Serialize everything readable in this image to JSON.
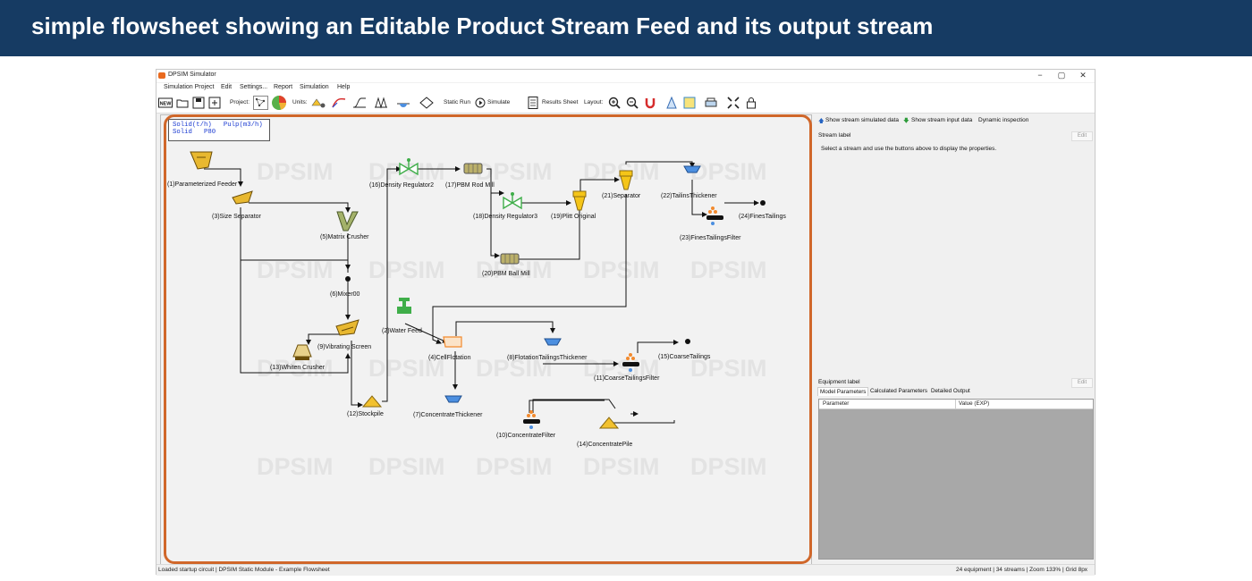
{
  "banner": {
    "title": "simple flowsheet showing an Editable Product Stream Feed and its output stream"
  },
  "window": {
    "title": "DPSIM Simulator",
    "controls": {
      "minimize": "−",
      "maximize": "▢",
      "close": "✕"
    }
  },
  "menu": [
    "Simulation Project",
    "Edit",
    "Settings...",
    "Report",
    "Simulation",
    "Help"
  ],
  "toolbar": {
    "project_label": "Project:",
    "units_label": "Units:",
    "static_run": "Static Run",
    "simulate": "Simulate",
    "results_sheet": "Results Sheet",
    "layout_label": "Layout:",
    "new_label": "NEW"
  },
  "legend": {
    "line1": "Solid(t/h)   Pulp(m3/h)",
    "line2": "Solid   P80"
  },
  "watermark": "DPSIM",
  "nodes": {
    "n1": "(1)Parameterized Feeder",
    "n3": "(3)Size Separator",
    "n5": "(5)Matrix Crusher",
    "n6": "(6)Mixer00",
    "n9": "(9)Vibrating Screen",
    "n13": "(13)Whiten Crusher",
    "n12": "(12)Stockpile",
    "n16": "(16)Density Regulator2",
    "n17": "(17)PBM Rod Mill",
    "n18": "(18)Density Regulator3",
    "n19": "(19)Plitt Original",
    "n20": "(20)PBM Ball Mill",
    "n21": "(21)Separator",
    "n22": "(22)TailinsThickener",
    "n23": "(23)FinesTailingsFilter",
    "n24": "(24)FinesTailings",
    "n2": "(2)Water Feed",
    "n4": "(4)CellFlotation",
    "n8": "(8)FlotationTailingsThickener",
    "n11": "(11)CoarseTailingsFilter",
    "n15": "(15)CoarseTailings",
    "n7": "(7)ConcentrateThickener",
    "n10": "(10)ConcentrateFilter",
    "n14": "(14)ConcentratePile"
  },
  "right_panel": {
    "show_simulated": "Show stream simulated data",
    "show_input": "Show stream input data",
    "dynamic": "Dynamic inspection",
    "stream_label": "Stream label",
    "edit": "Edit",
    "hint": "Select a stream and use the buttons above to display the properties.",
    "equipment_label": "Equipment label",
    "tabs": [
      "Model Parameters",
      "Calculated Parameters",
      "Detailed Output"
    ],
    "grid_cols": [
      "Parameter",
      "Value (EXP)"
    ]
  },
  "status": {
    "left": "Loaded startup circuit | DPSIM Static Module - Example Flowsheet",
    "right": "24 equipment | 34 streams | Zoom 133% | Grid 8px"
  },
  "colors": {
    "banner": "#163b63",
    "highlight": "#d0672a",
    "equipment": "#e8b830",
    "valve": "#3fae49"
  }
}
